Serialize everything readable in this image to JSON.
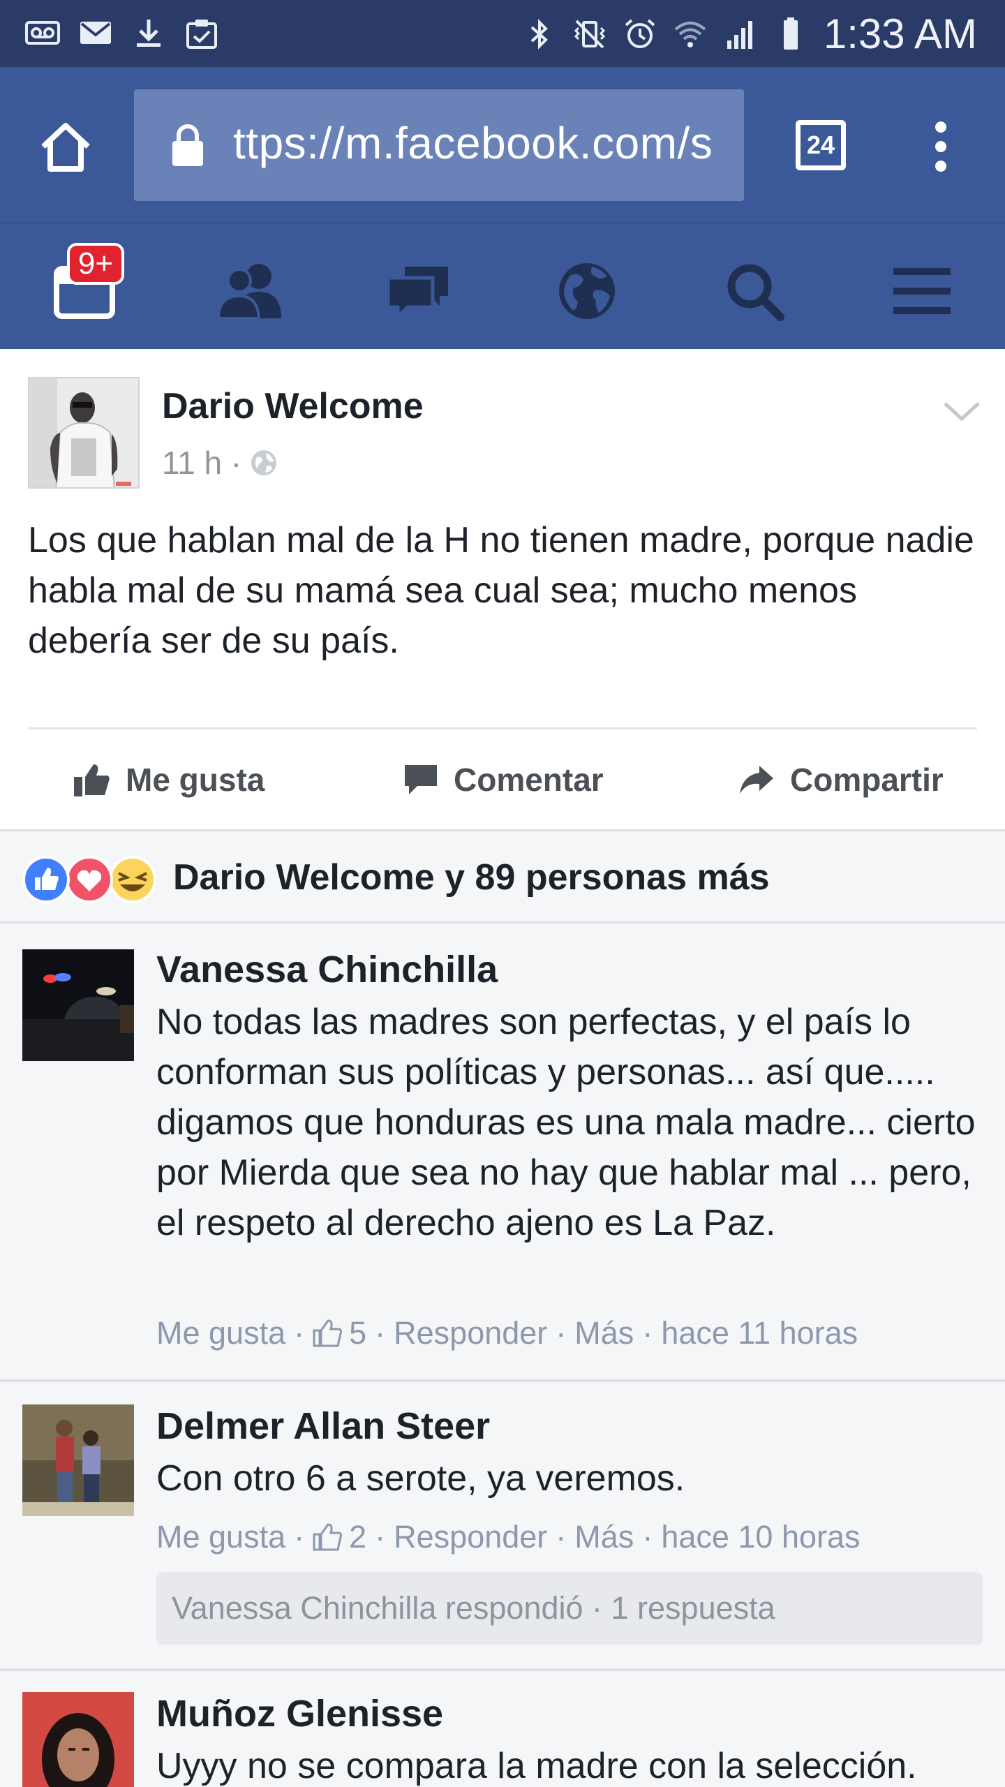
{
  "status_bar": {
    "time": "1:33 AM",
    "left_icons": [
      "voicemail-icon",
      "mail-icon",
      "download-icon",
      "clipboard-check-icon"
    ],
    "right_icons": [
      "bluetooth-icon",
      "vibrate-icon",
      "alarm-icon",
      "wifi-icon",
      "signal-icon",
      "battery-icon"
    ]
  },
  "browser": {
    "url": "ttps://m.facebook.com/s",
    "tab_count": "24"
  },
  "fb_nav": {
    "notification_badge": "9+",
    "items": [
      "notifications-icon",
      "friends-icon",
      "messages-icon",
      "globe-icon",
      "search-icon",
      "menu-icon"
    ]
  },
  "post": {
    "author": "Dario Welcome",
    "time": "11 h ·",
    "text": "Los que hablan mal de la H no tienen madre, porque nadie habla mal de su mamá sea cual sea; mucho menos debería ser de su país.",
    "actions": {
      "like": "Me gusta",
      "comment": "Comentar",
      "share": "Compartir"
    }
  },
  "reactions": {
    "summary": "Dario Welcome y 89 personas más",
    "colors": {
      "like": "#4080ff",
      "love": "#f25268",
      "haha": "#fcd35c"
    }
  },
  "comments": [
    {
      "name": "Vanessa Chinchilla",
      "text": "No todas las madres son perfectas, y el país lo conforman sus políticas y personas... así que..... digamos que honduras es una mala madre... cierto por Mierda que sea no hay que hablar mal ... pero, el respeto al derecho ajeno es La Paz.",
      "like": "Me gusta",
      "like_count": "5",
      "reply": "Responder",
      "more": "Más",
      "time": "hace 11 horas"
    },
    {
      "name": "Delmer Allan Steer",
      "text": "Con otro 6 a serote, ya veremos.",
      "like": "Me gusta",
      "like_count": "2",
      "reply": "Responder",
      "more": "Más",
      "time": "hace 10 horas",
      "reply_summary": "Vanessa Chinchilla respondió · 1 respuesta"
    },
    {
      "name": "Muñoz Glenisse",
      "text": "Uyyy no se compara la madre con la selección."
    }
  ],
  "colors": {
    "fb_blue": "#3b5998",
    "status_bar": "#2a3b68",
    "meta_text": "#8d98ad"
  }
}
